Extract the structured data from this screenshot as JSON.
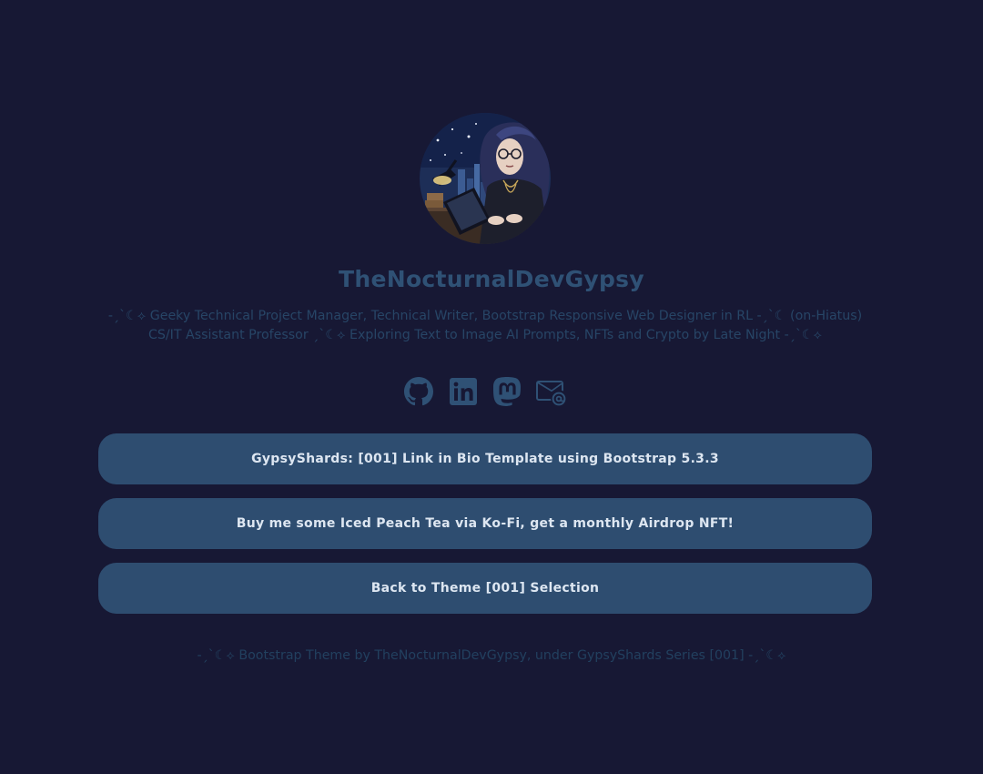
{
  "profile": {
    "name": "TheNocturnalDevGypsy",
    "bio": "-ˏˋ☾⟡ Geeky Technical Project Manager, Technical Writer, Bootstrap Responsive Web Designer in RL -ˏˋ☾ (on-Hiatus) CS/IT Assistant Professor ˏˋ☾⟡ Exploring Text to Image AI Prompts, NFTs and Crypto by Late Night -ˏˋ☾⟡"
  },
  "socials": [
    {
      "icon": "github-icon"
    },
    {
      "icon": "linkedin-icon"
    },
    {
      "icon": "mastodon-icon"
    },
    {
      "icon": "envelope-at-icon"
    }
  ],
  "links": [
    {
      "label": "GypsyShards: [001] Link in Bio Template using Bootstrap 5.3.3"
    },
    {
      "label": "Buy me some Iced Peach Tea via Ko-Fi, get a monthly Airdrop NFT!"
    },
    {
      "label": "Back to Theme [001] Selection"
    }
  ],
  "footer": {
    "text": "-ˏˋ☾⟡ Bootstrap Theme by TheNocturnalDevGypsy, under GypsyShards Series [001] -ˏˋ☾⟡"
  },
  "colors": {
    "background": "#171834",
    "accent": "#2f5175",
    "button_bg": "#2e4d70",
    "button_text": "#dde6f1"
  }
}
